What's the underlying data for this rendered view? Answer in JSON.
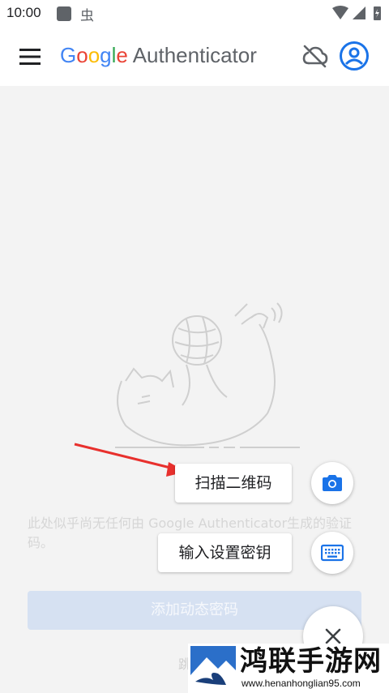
{
  "status": {
    "time": "10:00"
  },
  "header": {
    "brand_google": [
      "G",
      "o",
      "o",
      "g",
      "l",
      "e"
    ],
    "brand_product": "Authenticator"
  },
  "empty_state": {
    "message": "此处似乎尚无任何由 Google Authenticator生成的验证码。"
  },
  "actions": {
    "add_button": "添加动态密码",
    "skip_text": "跳",
    "scan_qr": "扫描二维码",
    "enter_key": "输入设置密钥"
  },
  "watermark": {
    "title": "鸿联手游网",
    "url": "www.henanhonglian95.com"
  },
  "colors": {
    "accent": "#1a73e8",
    "arrow": "#e8302d"
  },
  "icons": [
    "menu-icon",
    "cloud-off-icon",
    "account-circle-icon",
    "camera-icon",
    "keyboard-icon",
    "close-icon",
    "cat-yarn-illustration"
  ]
}
